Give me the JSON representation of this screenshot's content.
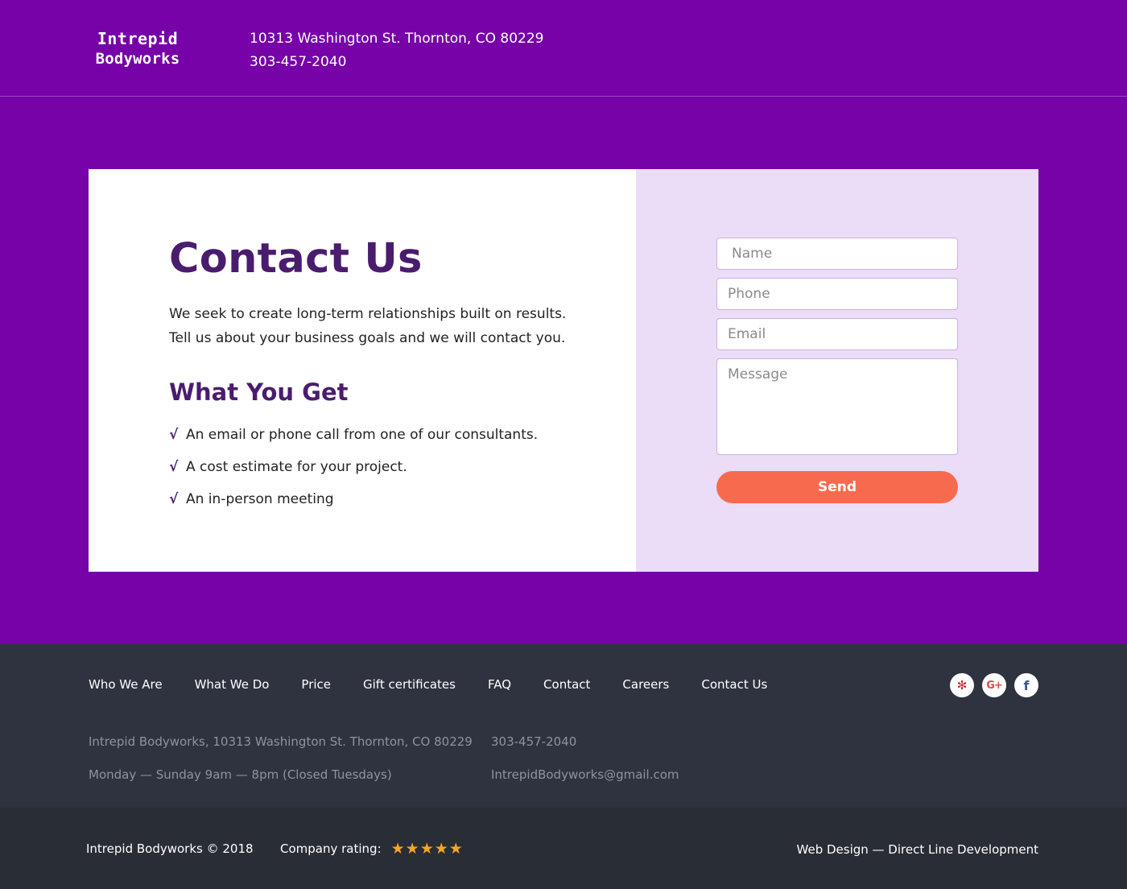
{
  "header": {
    "logo_line1": "Intrepid",
    "logo_line2": "Bodyworks",
    "address": "10313 Washington St. Thornton, CO 80229",
    "phone": "303-457-2040"
  },
  "contact": {
    "title": "Contact Us",
    "intro_line1": "We seek to create long-term relationships built on results.",
    "intro_line2": "Tell us about your business goals and we will contact you.",
    "subtitle": "What You Get",
    "check_symbol": "√",
    "benefits": [
      "An email or phone call from one of our consultants.",
      "A cost estimate for your project.",
      "An in-person meeting"
    ]
  },
  "form": {
    "name_placeholder": "Name",
    "phone_placeholder": "Phone",
    "email_placeholder": "Email",
    "message_placeholder": "Message",
    "send_label": "Send"
  },
  "footer": {
    "nav": [
      "Who We Are",
      "What We Do",
      "Price",
      "Gift certificates",
      "FAQ",
      "Contact",
      "Careers",
      "Contact Us"
    ],
    "social": [
      {
        "icon": "yelp-icon",
        "glyph": "✻"
      },
      {
        "icon": "google-plus-icon",
        "glyph": "G+"
      },
      {
        "icon": "facebook-icon",
        "glyph": "f"
      }
    ],
    "address": "Intrepid Bodyworks, 10313 Washington St. Thornton, CO 80229",
    "hours": "Monday — Sunday 9am — 8pm (Closed Tuesdays)",
    "phone": "303-457-2040",
    "email": "IntrepidBodyworks@gmail.com"
  },
  "bottom": {
    "copyright": "Intrepid Bodyworks © 2018",
    "rating_label": "Company rating:",
    "rating_value": 5,
    "rating_max": 5,
    "stars": "★★★★★",
    "credit": "Web Design — Direct Line Development"
  },
  "colors": {
    "brand_purple": "#7602a8",
    "heading_purple": "#4a1c6e",
    "form_panel": "#ebdcf8",
    "send_button": "#f86a4e",
    "footer": "#2e333f",
    "bottom_bar": "#292d36",
    "star": "#f6a623"
  }
}
